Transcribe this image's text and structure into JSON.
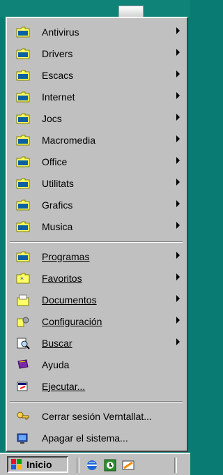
{
  "menu": {
    "items": [
      {
        "label": "Antivirus",
        "icon": "folder-icon",
        "has_submenu": true
      },
      {
        "label": "Drivers",
        "icon": "folder-icon",
        "has_submenu": true
      },
      {
        "label": "Escacs",
        "icon": "folder-icon",
        "has_submenu": true
      },
      {
        "label": "Internet",
        "icon": "folder-icon",
        "has_submenu": true
      },
      {
        "label": "Jocs",
        "icon": "folder-icon",
        "has_submenu": true
      },
      {
        "label": "Macromedia",
        "icon": "folder-icon",
        "has_submenu": true
      },
      {
        "label": "Office",
        "icon": "folder-icon",
        "has_submenu": true
      },
      {
        "label": "Utilitats",
        "icon": "folder-icon",
        "has_submenu": true
      },
      {
        "label": "Grafics",
        "icon": "folder-icon",
        "has_submenu": true
      },
      {
        "label": "Musica",
        "icon": "folder-icon",
        "has_submenu": true
      }
    ],
    "system_items": [
      {
        "label": "Programas",
        "icon": "programs-folder-icon",
        "has_submenu": true
      },
      {
        "label": "Favoritos",
        "icon": "favorites-folder-icon",
        "has_submenu": true
      },
      {
        "label": "Documentos",
        "icon": "documents-folder-icon",
        "has_submenu": true
      },
      {
        "label": "Configuración",
        "icon": "control-panel-icon",
        "has_submenu": true
      },
      {
        "label": "Buscar",
        "icon": "find-icon",
        "has_submenu": true
      },
      {
        "label": "Ayuda",
        "icon": "help-book-icon",
        "has_submenu": false
      },
      {
        "label": "Ejecutar...",
        "icon": "run-icon",
        "has_submenu": false
      }
    ],
    "session_items": [
      {
        "label": "Cerrar sesión Verntallat...",
        "icon": "logoff-key-icon",
        "has_submenu": false
      },
      {
        "label": "Apagar el sistema...",
        "icon": "shutdown-icon",
        "has_submenu": false
      }
    ]
  },
  "taskbar": {
    "start_label": "Inicio",
    "quicklaunch": [
      "internet-explorer-icon",
      "outlook-express-icon",
      "show-desktop-icon"
    ]
  },
  "colors": {
    "desktop": "#0a7b72",
    "menu_bg": "#c0c0c0",
    "folder_yellow": "#ffff66"
  }
}
